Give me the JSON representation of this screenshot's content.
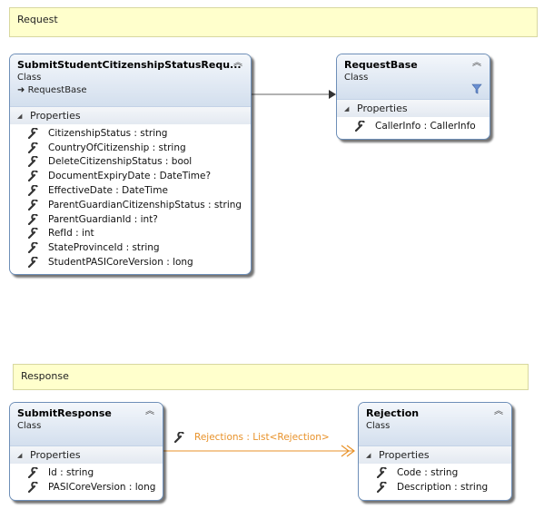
{
  "notes": {
    "request": "Request",
    "response": "Response"
  },
  "classes": {
    "submit_student": {
      "name": "SubmitStudentCitizenshipStatusRequ...",
      "kind": "Class",
      "base": "RequestBase",
      "section": "Properties",
      "members": [
        "CitizenshipStatus : string",
        "CountryOfCitizenship : string",
        "DeleteCitizenshipStatus : bool",
        "DocumentExpiryDate : DateTime?",
        "EffectiveDate : DateTime",
        "ParentGuardianCitizenshipStatus : string",
        "ParentGuardianId : int?",
        "RefId : int",
        "StateProvinceId : string",
        "StudentPASICoreVersion : long"
      ]
    },
    "request_base": {
      "name": "RequestBase",
      "kind": "Class",
      "section": "Properties",
      "members": [
        "CallerInfo : CallerInfo"
      ]
    },
    "submit_response": {
      "name": "SubmitResponse",
      "kind": "Class",
      "section": "Properties",
      "members": [
        "Id : string",
        "PASICoreVersion : long"
      ]
    },
    "rejection": {
      "name": "Rejection",
      "kind": "Class",
      "section": "Properties",
      "members": [
        "Code : string",
        "Description : string"
      ]
    }
  },
  "associations": {
    "rejections_label": "Rejections : List<Rejection>"
  },
  "colors": {
    "note_fill": "#ffffcc",
    "class_border": "#6e8fb8",
    "association": "#e8922a"
  },
  "icons": {
    "member": "wrench-icon",
    "collapse": "chevron-up-icon",
    "section_toggle": "triangle-down-icon",
    "filter": "filter-icon"
  }
}
